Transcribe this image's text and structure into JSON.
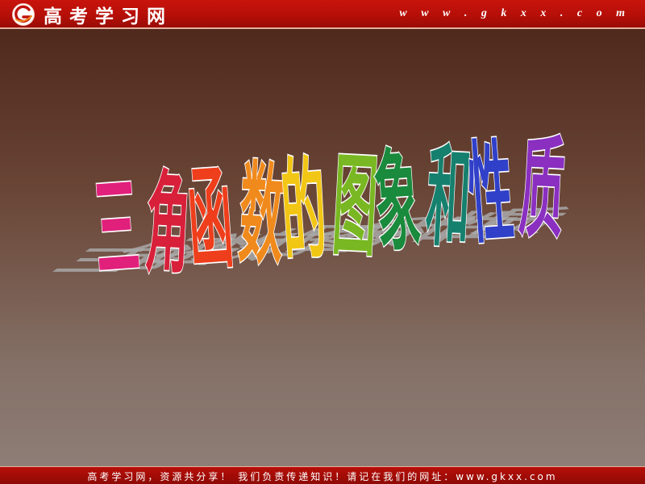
{
  "header": {
    "logo_icon": "g-swoosh-logo-icon",
    "logo_text": "高考学习网",
    "url": "w w w . g k x x . c o m"
  },
  "title": {
    "characters": [
      {
        "char": "三",
        "color": "#e0207a"
      },
      {
        "char": "角",
        "color": "#d8203a"
      },
      {
        "char": "函",
        "color": "#ee3e1c"
      },
      {
        "char": "数",
        "color": "#f08a1c"
      },
      {
        "char": "的",
        "color": "#f2c614"
      },
      {
        "char": "图",
        "color": "#79b822"
      },
      {
        "char": "象",
        "color": "#1a8a3c"
      },
      {
        "char": "和",
        "color": "#16806e"
      },
      {
        "char": "性",
        "color": "#3040c8"
      },
      {
        "char": "质",
        "color": "#8a2fc0"
      }
    ],
    "outline_color": "#ffffff",
    "shadow_color": "#a8a8a8"
  },
  "footer": {
    "text": "高考学习网，资源共分享！ 我们负责传递知识！请记在我们的网址：www.gkxx.com"
  },
  "colors": {
    "header_bg": "#c0120a",
    "background_top": "#4a2418",
    "background_bottom": "#8f8079"
  }
}
